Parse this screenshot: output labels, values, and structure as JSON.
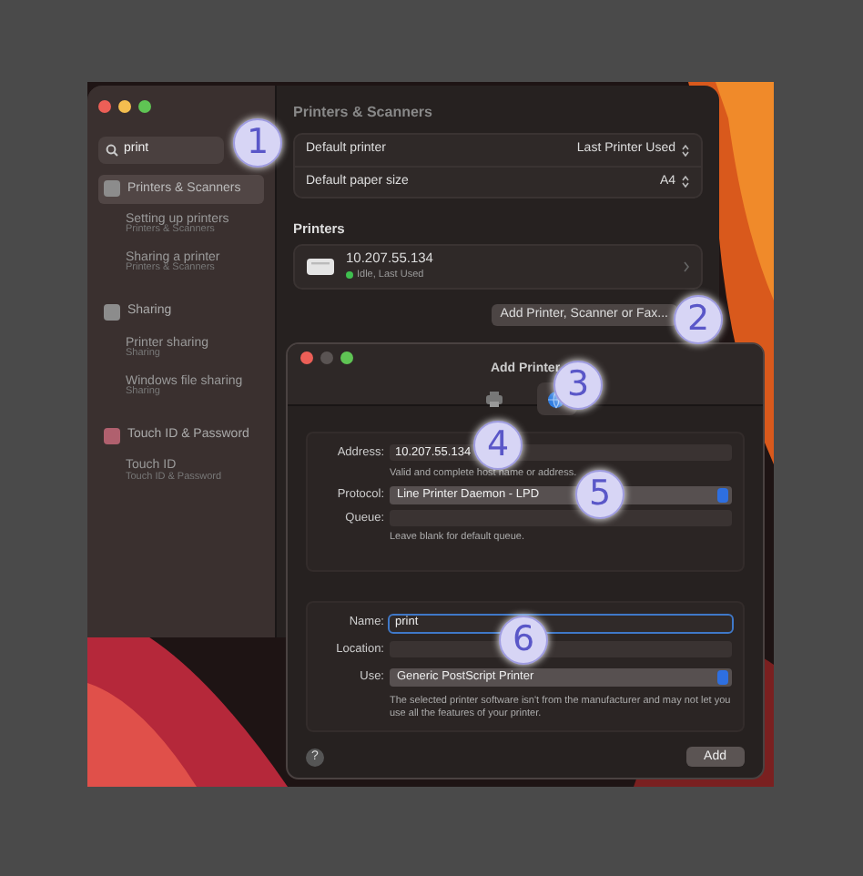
{
  "settings_window": {
    "controls": [
      {
        "kind": "close",
        "enabled": true
      },
      {
        "kind": "minimize",
        "enabled": true
      },
      {
        "kind": "zoom",
        "enabled": true
      }
    ],
    "sidebar": {
      "search": {
        "value": "print"
      },
      "items": [
        {
          "label": "Printers & Scanners",
          "selected": true,
          "color": "#8c8c8c",
          "children": [
            {
              "title": "Setting up printers",
              "subtitle": "Printers & Scanners"
            },
            {
              "title": "Sharing a printer",
              "subtitle": "Printers & Scanners"
            }
          ]
        },
        {
          "label": "Sharing",
          "selected": false,
          "color": "#8c8c8c",
          "children": [
            {
              "title": "Printer sharing",
              "subtitle": "Sharing"
            },
            {
              "title": "Windows file sharing",
              "subtitle": "Sharing"
            }
          ]
        },
        {
          "label": "Touch ID & Password",
          "selected": false,
          "color": "#b0606e",
          "children": [
            {
              "title": "Touch ID",
              "subtitle": "Touch ID & Password"
            }
          ]
        }
      ]
    },
    "title": "Printers & Scanners",
    "settings": [
      {
        "label": "Default printer",
        "value": "Last Printer Used"
      },
      {
        "label": "Default paper size",
        "value": "A4"
      }
    ],
    "printers_heading": "Printers",
    "printers": [
      {
        "name": "10.207.55.134",
        "status": "Idle, Last Used",
        "color": "#3fbf4f"
      }
    ],
    "add_button": "Add Printer, Scanner or Fax..."
  },
  "add_printer_dialog": {
    "title": "Add Printer",
    "controls": [
      {
        "kind": "close",
        "enabled": true
      },
      {
        "kind": "minimize",
        "enabled": false
      },
      {
        "kind": "zoom",
        "enabled": true
      }
    ],
    "tabs": [
      {
        "kind": "default",
        "selected": false
      },
      {
        "kind": "ip",
        "selected": true
      }
    ],
    "address": {
      "label": "Address:",
      "value": "10.207.55.134",
      "hint": "Valid and complete host name or address."
    },
    "protocol": {
      "label": "Protocol:",
      "value": "Line Printer Daemon - LPD"
    },
    "queue": {
      "label": "Queue:",
      "hint": "Leave blank for default queue."
    },
    "name": {
      "label": "Name:",
      "value": "print",
      "focused": true
    },
    "location": {
      "label": "Location:"
    },
    "use": {
      "label": "Use:",
      "value": "Generic PostScript Printer",
      "note": "The selected printer software isn't from the manufacturer and may not let you use all the features of your printer."
    },
    "help_button": "?",
    "add_button": "Add"
  },
  "annotations": [
    "1",
    "2",
    "3",
    "4",
    "5",
    "6"
  ]
}
